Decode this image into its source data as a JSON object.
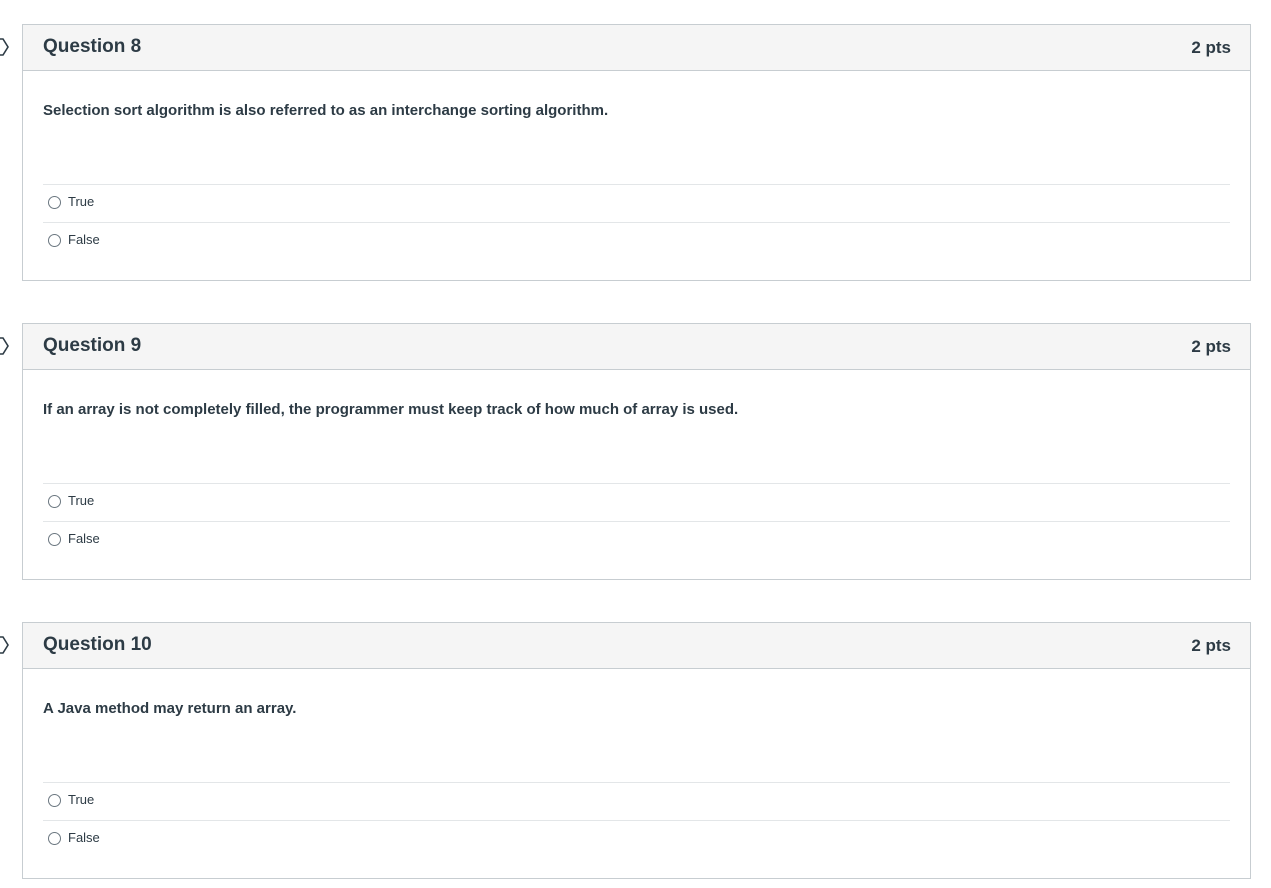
{
  "questions": [
    {
      "title": "Question 8",
      "points": "2 pts",
      "text": "Selection sort algorithm is also referred to as an interchange sorting algorithm.",
      "answers": [
        "True",
        "False"
      ]
    },
    {
      "title": "Question 9",
      "points": "2 pts",
      "text": "If an array is not completely filled, the programmer must keep track of how much of array is used.",
      "answers": [
        "True",
        "False"
      ]
    },
    {
      "title": "Question 10",
      "points": "2 pts",
      "text": "A Java method may return an array.",
      "answers": [
        "True",
        "False"
      ]
    }
  ],
  "icons": {
    "flag": "flag-question-icon",
    "radio": "radio-button-unselected"
  },
  "colors": {
    "header_bg": "#f5f5f5",
    "border": "#c7cdd1",
    "text": "#2d3b45"
  }
}
